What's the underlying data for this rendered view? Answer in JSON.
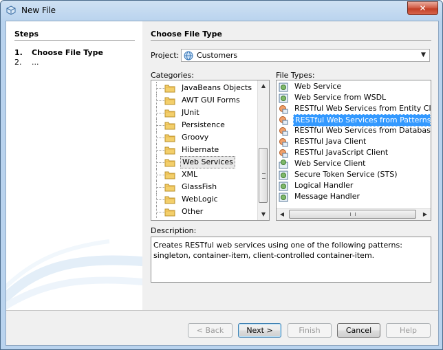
{
  "window": {
    "title": "New File",
    "close_glyph": "✕"
  },
  "steps": {
    "title": "Steps",
    "items": [
      {
        "num": "1.",
        "label": "Choose File Type"
      },
      {
        "num": "2.",
        "label": "..."
      }
    ]
  },
  "main": {
    "title": "Choose File Type",
    "project_label": "Project:",
    "project_value": "Customers",
    "categories_label": "Categories:",
    "file_types_label": "File Types:",
    "description_label": "Description:",
    "description_text": "Creates RESTful web services using one of the following patterns: singleton, container-item, client-controlled container-item."
  },
  "categories": [
    "JavaBeans Objects",
    "AWT GUI Forms",
    "JUnit",
    "Persistence",
    "Groovy",
    "Hibernate",
    "Web Services",
    "XML",
    "GlassFish",
    "WebLogic",
    "Other"
  ],
  "selected_category": "Web Services",
  "file_types": [
    {
      "label": "Web Service",
      "icon": "web-service-icon"
    },
    {
      "label": "Web Service from WSDL",
      "icon": "web-service-icon"
    },
    {
      "label": "RESTful Web Services from Entity Classes",
      "icon": "rest-icon"
    },
    {
      "label": "RESTful Web Services from Patterns",
      "icon": "rest-icon"
    },
    {
      "label": "RESTful Web Services from Database",
      "icon": "rest-icon"
    },
    {
      "label": "RESTful Java Client",
      "icon": "rest-icon"
    },
    {
      "label": "RESTful JavaScript Client",
      "icon": "rest-icon"
    },
    {
      "label": "Web Service Client",
      "icon": "web-service-client-icon"
    },
    {
      "label": "Secure Token Service (STS)",
      "icon": "web-service-icon"
    },
    {
      "label": "Logical Handler",
      "icon": "web-service-icon"
    },
    {
      "label": "Message Handler",
      "icon": "web-service-icon"
    }
  ],
  "selected_file_type": "RESTful Web Services from Patterns",
  "buttons": {
    "back": "< Back",
    "next": "Next >",
    "finish": "Finish",
    "cancel": "Cancel",
    "help": "Help"
  },
  "colors": {
    "selection": "#3399ff",
    "title_bar": "#b9d3ee"
  }
}
